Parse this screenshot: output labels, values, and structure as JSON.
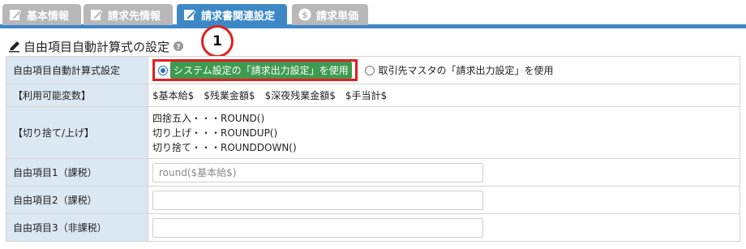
{
  "tabs": [
    {
      "label": "基本情報",
      "icon": "edit-icon",
      "active": false
    },
    {
      "label": "請求先情報",
      "icon": "edit-icon",
      "active": false
    },
    {
      "label": "請求書関連設定",
      "icon": "edit-icon",
      "active": true
    },
    {
      "label": "請求単価",
      "icon": "dollar-icon",
      "active": false
    }
  ],
  "section": {
    "title": "自由項目自動計算式の設定",
    "pen_icon": "pencil-icon",
    "help_icon": "help-icon"
  },
  "annotation": {
    "number": "1"
  },
  "rows": {
    "formula_setting": {
      "label": "自由項目自動計算式設定",
      "option1": "システム設定の「請求出力設定」を使用",
      "option2": "取引先マスタの「請求出力設定」を使用",
      "selected": 1
    },
    "variables": {
      "label": "【利用可能変数】",
      "values": [
        "$基本給$",
        "$残業金額$",
        "$深夜残業金額$",
        "$手当計$"
      ]
    },
    "rounding": {
      "label": "【切り捨て/上げ】",
      "lines": [
        "四捨五入・・・ROUND()",
        "切り上げ・・・ROUNDUP()",
        "切り捨て・・・ROUNDDOWN()"
      ]
    },
    "free1": {
      "label": "自由項目1（課税）",
      "value": "round($基本給$)"
    },
    "free2": {
      "label": "自由項目2（課税）",
      "value": ""
    },
    "free3": {
      "label": "自由項目3（非課税）",
      "value": ""
    }
  },
  "colors": {
    "tab_active": "#3d87c6",
    "tab_inactive": "#b8b8b8",
    "label_bg": "#dbe7f3",
    "selected_option_bg": "#3e9a4f",
    "highlight": "#e02020"
  }
}
